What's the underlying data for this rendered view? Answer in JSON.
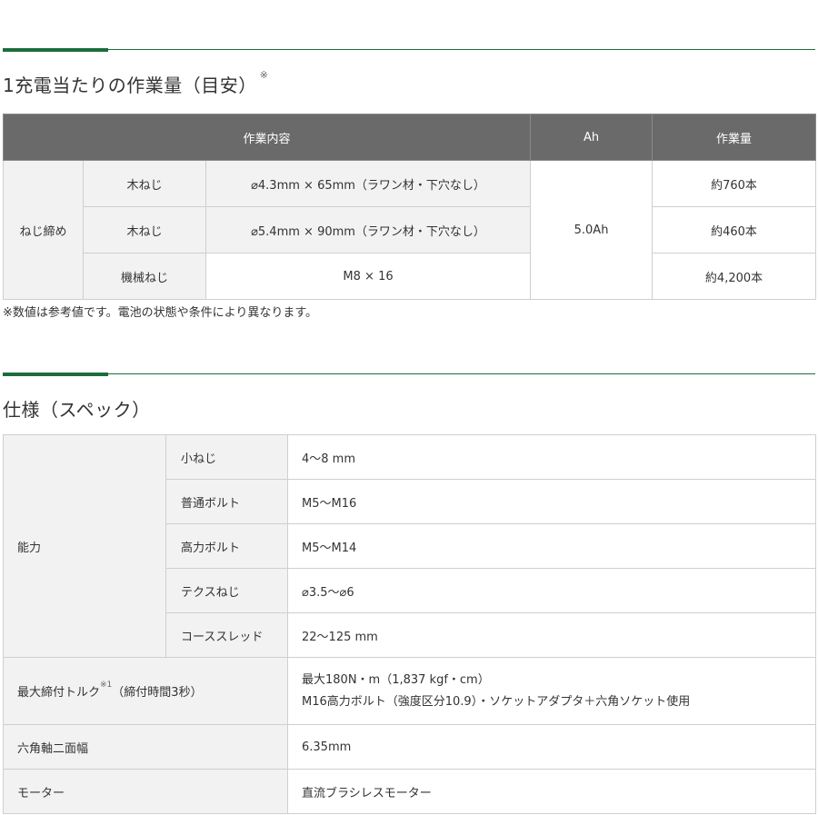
{
  "work_section": {
    "title": "1充電当たりの作業量（目安）",
    "title_mark": "※",
    "headers": {
      "content": "作業内容",
      "ah": "Ah",
      "amount": "作業量"
    },
    "category": "ねじ締め",
    "battery": "5.0Ah",
    "rows": [
      {
        "type": "木ねじ",
        "spec": "⌀4.3mm × 65mm（ラワン材・下穴なし）",
        "amount": "約760本"
      },
      {
        "type": "木ねじ",
        "spec": "⌀5.4mm × 90mm（ラワン材・下穴なし）",
        "amount": "約460本"
      },
      {
        "type": "機械ねじ",
        "spec": "M8 × 16",
        "amount": "約4,200本"
      }
    ],
    "note": "※数値は参考値です。電池の状態や条件により異なります。"
  },
  "spec_section": {
    "title": "仕様（スペック）",
    "capacity": {
      "label": "能力",
      "rows": [
        {
          "label": "小ねじ",
          "value": "4～8 mm"
        },
        {
          "label": "普通ボルト",
          "value": "M5～M16"
        },
        {
          "label": "高力ボルト",
          "value": "M5～M14"
        },
        {
          "label": "テクスねじ",
          "value": "⌀3.5～⌀6"
        },
        {
          "label": "コーススレッド",
          "value": "22～125 mm"
        }
      ]
    },
    "torque": {
      "label": "最大締付トルク",
      "mark": "※1",
      "label_suffix": "（締付時間3秒）",
      "value_line1": "最大180N・m（1,837 kgf・cm）",
      "value_line2": "M16高力ボルト（強度区分10.9）・ソケットアダプタ＋六角ソケット使用"
    },
    "hex": {
      "label": "六角軸二面幅",
      "value": "6.35mm"
    },
    "motor": {
      "label": "モーター",
      "value": "直流ブラシレスモーター"
    }
  }
}
